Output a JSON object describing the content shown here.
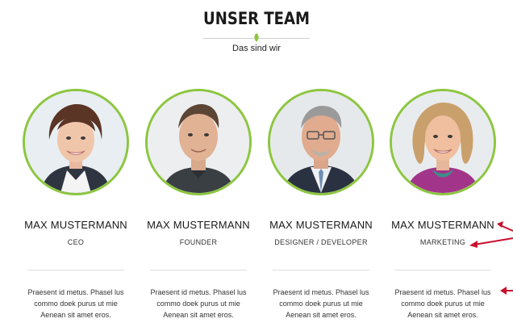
{
  "header": {
    "title": "UNSER TEAM",
    "subtitle": "Das sind wir"
  },
  "colors": {
    "accent_green": "#8cc63f",
    "annotation_red": "#c8102e"
  },
  "members": [
    {
      "name": "MAX MUSTERMANN",
      "role": "CEO",
      "description": "Praesent id metus. Phasel lus commo doek purus ut mie Aenean sit amet eros."
    },
    {
      "name": "MAX MUSTERMANN",
      "role": "FOUNDER",
      "description": "Praesent id metus. Phasel lus commo doek purus ut mie Aenean sit amet eros."
    },
    {
      "name": "MAX MUSTERMANN",
      "role": "DESIGNER / DEVELOPER",
      "description": "Praesent id metus. Phasel lus commo doek purus ut mie Aenean sit amet eros."
    },
    {
      "name": "MAX MUSTERMANN",
      "role": "MARKETING",
      "description": "Praesent id metus. Phasel lus commo doek purus ut mie Aenean sit amet eros."
    }
  ],
  "icons": {
    "divider": "leaf-icon",
    "annotations": "arrow-icon"
  }
}
